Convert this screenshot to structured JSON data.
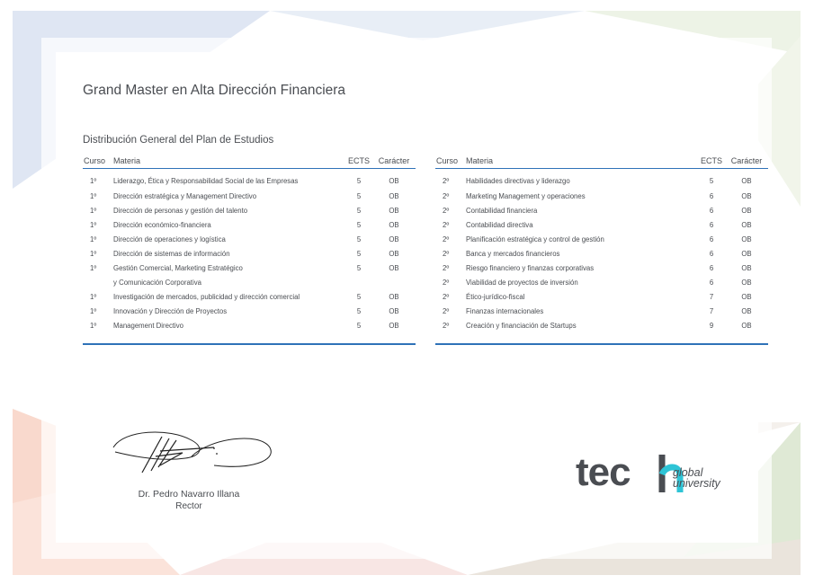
{
  "colors": {
    "accent": "#2f72b8",
    "text": "#4a4d52",
    "logo_accent": "#2ec4d6"
  },
  "document": {
    "title": "Grand Master en Alta Dirección Financiera",
    "subtitle": "Distribución General del Plan de Estudios"
  },
  "columns": {
    "curso": "Curso",
    "materia": "Materia",
    "ects": "ECTS",
    "caracter": "Carácter"
  },
  "left_rows": [
    {
      "curso": "1º",
      "materia": "Liderazgo, Ética y Responsabilidad Social de las Empresas",
      "ects": "5",
      "caracter": "OB"
    },
    {
      "curso": "1º",
      "materia": "Dirección estratégica y Management Directivo",
      "ects": "5",
      "caracter": "OB"
    },
    {
      "curso": "1º",
      "materia": "Dirección de personas y gestión del talento",
      "ects": "5",
      "caracter": "OB"
    },
    {
      "curso": "1º",
      "materia": "Dirección económico-financiera",
      "ects": "5",
      "caracter": "OB"
    },
    {
      "curso": "1º",
      "materia": "Dirección de operaciones y logística",
      "ects": "5",
      "caracter": "OB"
    },
    {
      "curso": "1º",
      "materia": "Dirección de sistemas de información",
      "ects": "5",
      "caracter": "OB"
    },
    {
      "curso": "1º",
      "materia": "Gestión Comercial, Marketing Estratégico",
      "ects": "5",
      "caracter": "OB"
    },
    {
      "curso": "",
      "materia": "y Comunicación Corporativa",
      "ects": "",
      "caracter": ""
    },
    {
      "curso": "1º",
      "materia": "Investigación de mercados, publicidad y dirección comercial",
      "ects": "5",
      "caracter": "OB"
    },
    {
      "curso": "1º",
      "materia": "Innovación y Dirección de Proyectos",
      "ects": "5",
      "caracter": "OB"
    },
    {
      "curso": "1º",
      "materia": "Management Directivo",
      "ects": "5",
      "caracter": "OB"
    }
  ],
  "right_rows": [
    {
      "curso": "2º",
      "materia": "Habilidades directivas y liderazgo",
      "ects": "5",
      "caracter": "OB"
    },
    {
      "curso": "2º",
      "materia": "Marketing Management y operaciones",
      "ects": "6",
      "caracter": "OB"
    },
    {
      "curso": "2º",
      "materia": "Contabilidad financiera",
      "ects": "6",
      "caracter": "OB"
    },
    {
      "curso": "2º",
      "materia": "Contabilidad directiva",
      "ects": "6",
      "caracter": "OB"
    },
    {
      "curso": "2º",
      "materia": "Planificación estratégica y control de gestión",
      "ects": "6",
      "caracter": "OB"
    },
    {
      "curso": "2º",
      "materia": "Banca y mercados financieros",
      "ects": "6",
      "caracter": "OB"
    },
    {
      "curso": "2º",
      "materia": "Riesgo financiero y finanzas corporativas",
      "ects": "6",
      "caracter": "OB"
    },
    {
      "curso": "2º",
      "materia": "Viabilidad de proyectos de inversión",
      "ects": "6",
      "caracter": "OB"
    },
    {
      "curso": "2º",
      "materia": "Ético-jurídico-fiscal",
      "ects": "7",
      "caracter": "OB"
    },
    {
      "curso": "2º",
      "materia": "Finanzas internacionales",
      "ects": "7",
      "caracter": "OB"
    },
    {
      "curso": "2º",
      "materia": "Creación y financiación de Startups",
      "ects": "9",
      "caracter": "OB"
    }
  ],
  "signer": {
    "name": "Dr. Pedro Navarro Illana",
    "role": "Rector"
  },
  "logo": {
    "wordmark": "tech",
    "sub_line1": "global",
    "sub_line2": "university"
  }
}
